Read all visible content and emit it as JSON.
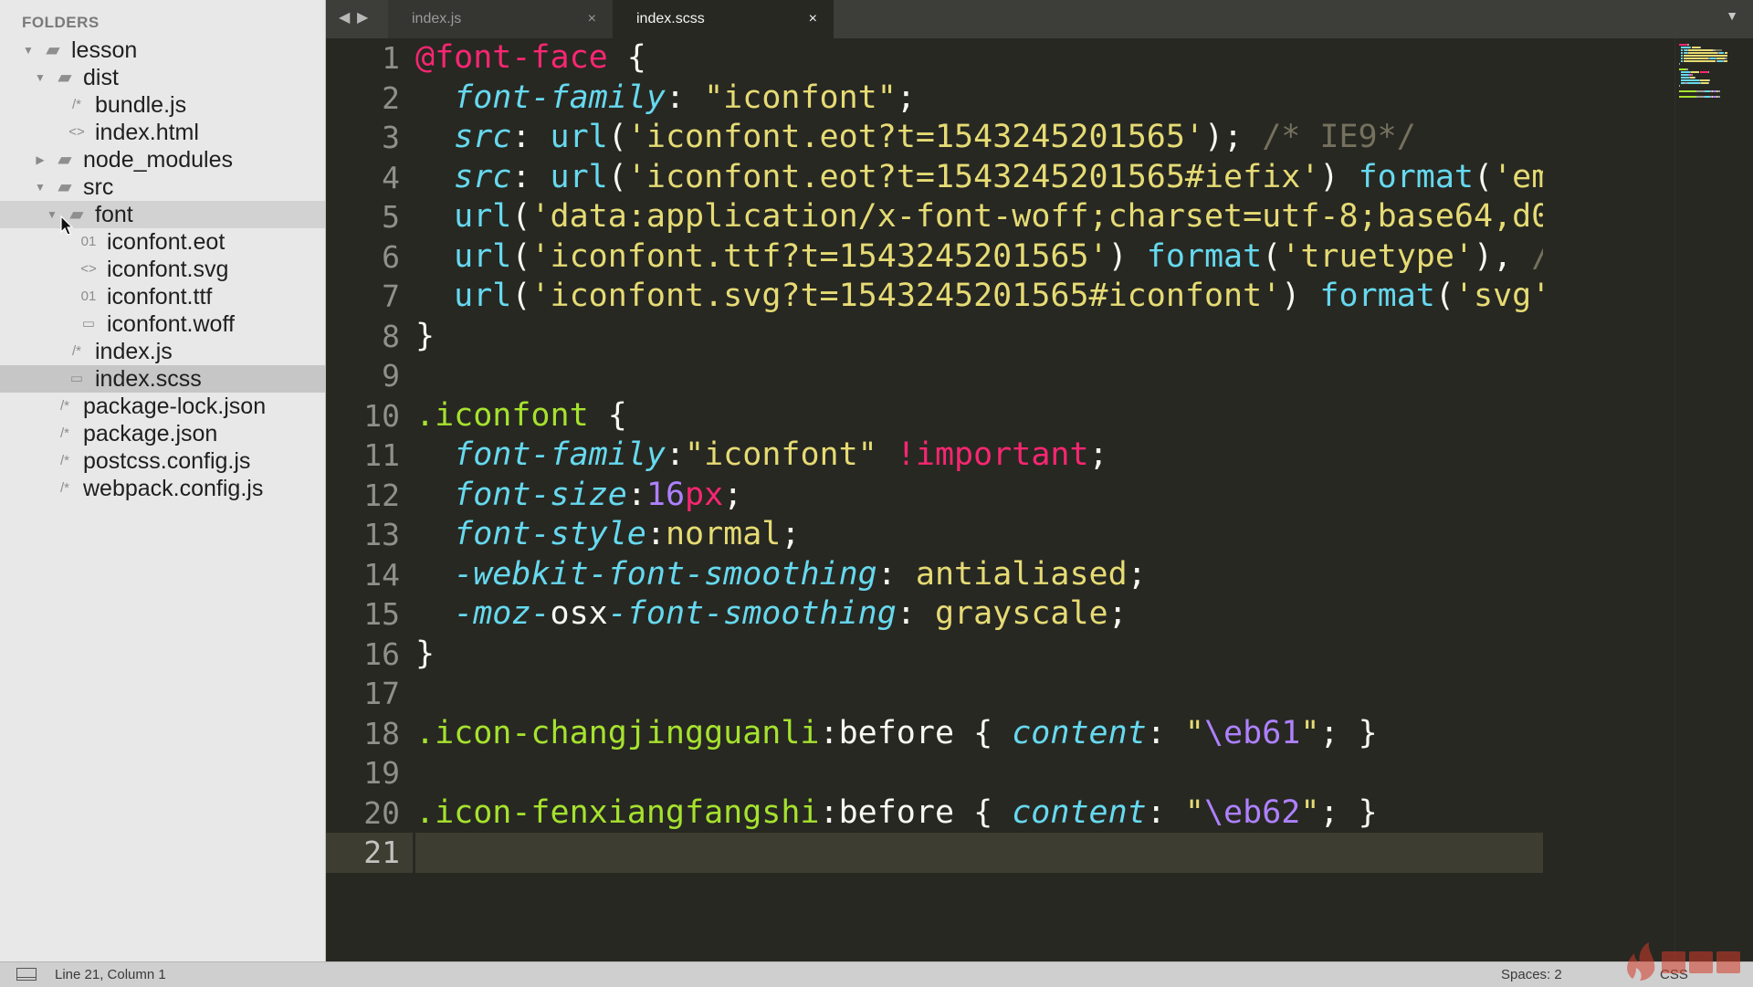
{
  "sidebar": {
    "heading": "FOLDERS",
    "tree": [
      {
        "label": "lesson",
        "type": "folder",
        "expanded": true,
        "depth": 0
      },
      {
        "label": "dist",
        "type": "folder",
        "expanded": true,
        "depth": 1
      },
      {
        "label": "bundle.js",
        "type": "file",
        "icon": "js-file-icon",
        "depth": 2
      },
      {
        "label": "index.html",
        "type": "file",
        "icon": "html-file-icon",
        "depth": 2
      },
      {
        "label": "node_modules",
        "type": "folder",
        "expanded": false,
        "depth": 1
      },
      {
        "label": "src",
        "type": "folder",
        "expanded": true,
        "depth": 1
      },
      {
        "label": "font",
        "type": "folder",
        "expanded": true,
        "depth": 2,
        "highlight": true
      },
      {
        "label": "iconfont.eot",
        "type": "file",
        "icon": "binary-file-icon",
        "depth": 3
      },
      {
        "label": "iconfont.svg",
        "type": "file",
        "icon": "html-file-icon",
        "depth": 3
      },
      {
        "label": "iconfont.ttf",
        "type": "file",
        "icon": "binary-file-icon",
        "depth": 3
      },
      {
        "label": "iconfont.woff",
        "type": "file",
        "icon": "plain-file-icon",
        "depth": 3
      },
      {
        "label": "index.js",
        "type": "file",
        "icon": "js-file-icon",
        "depth": 2
      },
      {
        "label": "index.scss",
        "type": "file",
        "icon": "plain-file-icon",
        "depth": 2,
        "selected": true
      },
      {
        "label": "package-lock.json",
        "type": "file",
        "icon": "js-file-icon",
        "depth": 1
      },
      {
        "label": "package.json",
        "type": "file",
        "icon": "js-file-icon",
        "depth": 1
      },
      {
        "label": "postcss.config.js",
        "type": "file",
        "icon": "js-file-icon",
        "depth": 1
      },
      {
        "label": "webpack.config.js",
        "type": "file",
        "icon": "js-file-icon",
        "depth": 1
      }
    ]
  },
  "tabs": [
    {
      "label": "index.js",
      "active": false,
      "close": "×"
    },
    {
      "label": "index.scss",
      "active": true,
      "close": "×"
    }
  ],
  "editor": {
    "current_line": 21,
    "lines": [
      [
        [
          "@font-face",
          "kw"
        ],
        [
          " {",
          "w"
        ]
      ],
      [
        [
          "  ",
          "w"
        ],
        [
          "font-family",
          "prop"
        ],
        [
          ": ",
          "w"
        ],
        [
          "\"iconfont\"",
          "str"
        ],
        [
          ";",
          "w"
        ]
      ],
      [
        [
          "  ",
          "w"
        ],
        [
          "src",
          "prop"
        ],
        [
          ": ",
          "w"
        ],
        [
          "url",
          "fn"
        ],
        [
          "(",
          "w"
        ],
        [
          "'iconfont.eot?t=1543245201565'",
          "str"
        ],
        [
          "); ",
          "w"
        ],
        [
          "/* IE9*/",
          "cm"
        ]
      ],
      [
        [
          "  ",
          "w"
        ],
        [
          "src",
          "prop"
        ],
        [
          ": ",
          "w"
        ],
        [
          "url",
          "fn"
        ],
        [
          "(",
          "w"
        ],
        [
          "'iconfont.eot?t=1543245201565#iefix'",
          "str"
        ],
        [
          ") ",
          "w"
        ],
        [
          "format",
          "fn"
        ],
        [
          "(",
          "w"
        ],
        [
          "'em",
          "str"
        ]
      ],
      [
        [
          "  ",
          "w"
        ],
        [
          "url",
          "fn"
        ],
        [
          "(",
          "w"
        ],
        [
          "'data:application/x-font-woff;charset=utf-8;base64,d0",
          "str"
        ]
      ],
      [
        [
          "  ",
          "w"
        ],
        [
          "url",
          "fn"
        ],
        [
          "(",
          "w"
        ],
        [
          "'iconfont.ttf?t=1543245201565'",
          "str"
        ],
        [
          ") ",
          "w"
        ],
        [
          "format",
          "fn"
        ],
        [
          "(",
          "w"
        ],
        [
          "'truetype'",
          "str"
        ],
        [
          "), ",
          "w"
        ],
        [
          "/",
          "cm"
        ]
      ],
      [
        [
          "  ",
          "w"
        ],
        [
          "url",
          "fn"
        ],
        [
          "(",
          "w"
        ],
        [
          "'iconfont.svg?t=1543245201565#iconfont'",
          "str"
        ],
        [
          ") ",
          "w"
        ],
        [
          "format",
          "fn"
        ],
        [
          "(",
          "w"
        ],
        [
          "'svg'",
          "str"
        ]
      ],
      [
        [
          "}",
          "w"
        ]
      ],
      [],
      [
        [
          ".iconfont",
          "sel"
        ],
        [
          " {",
          "w"
        ]
      ],
      [
        [
          "  ",
          "w"
        ],
        [
          "font-family",
          "prop"
        ],
        [
          ":",
          "w"
        ],
        [
          "\"iconfont\"",
          "str"
        ],
        [
          " ",
          "w"
        ],
        [
          "!important",
          "kw"
        ],
        [
          ";",
          "w"
        ]
      ],
      [
        [
          "  ",
          "w"
        ],
        [
          "font-size",
          "prop"
        ],
        [
          ":",
          "w"
        ],
        [
          "16",
          "num"
        ],
        [
          "px",
          "kw"
        ],
        [
          ";",
          "w"
        ]
      ],
      [
        [
          "  ",
          "w"
        ],
        [
          "font-style",
          "prop"
        ],
        [
          ":",
          "w"
        ],
        [
          "normal",
          "str"
        ],
        [
          ";",
          "w"
        ]
      ],
      [
        [
          "  ",
          "w"
        ],
        [
          "-webkit-font-smoothing",
          "prop"
        ],
        [
          ": ",
          "w"
        ],
        [
          "antialiased",
          "str"
        ],
        [
          ";",
          "w"
        ]
      ],
      [
        [
          "  ",
          "w"
        ],
        [
          "-moz-",
          "prop"
        ],
        [
          "osx",
          "w"
        ],
        [
          "-font-smoothing",
          "prop"
        ],
        [
          ": ",
          "w"
        ],
        [
          "grayscale",
          "str"
        ],
        [
          ";",
          "w"
        ]
      ],
      [
        [
          "}",
          "w"
        ]
      ],
      [],
      [
        [
          ".icon-changjingguanli",
          "sel"
        ],
        [
          ":before { ",
          "w"
        ],
        [
          "content",
          "prop"
        ],
        [
          ": ",
          "w"
        ],
        [
          "\"",
          "str"
        ],
        [
          "\\eb61",
          "esc"
        ],
        [
          "\"",
          "str"
        ],
        [
          "; }",
          "w"
        ]
      ],
      [],
      [
        [
          ".icon-fenxiangfangshi",
          "sel"
        ],
        [
          ":before { ",
          "w"
        ],
        [
          "content",
          "prop"
        ],
        [
          ": ",
          "w"
        ],
        [
          "\"",
          "str"
        ],
        [
          "\\eb62",
          "esc"
        ],
        [
          "\"",
          "str"
        ],
        [
          "; }",
          "w"
        ]
      ],
      []
    ]
  },
  "status": {
    "position": "Line 21, Column 1",
    "spaces": "Spaces: 2",
    "syntax": "CSS"
  },
  "colors": {
    "editor_bg": "#272822",
    "keyword": "#f92672",
    "property": "#66d9ef",
    "string": "#e6db74",
    "comment": "#75715e",
    "number": "#ae81ff",
    "selector": "#a6e22e",
    "sidebar_bg": "#e8e8e8"
  }
}
